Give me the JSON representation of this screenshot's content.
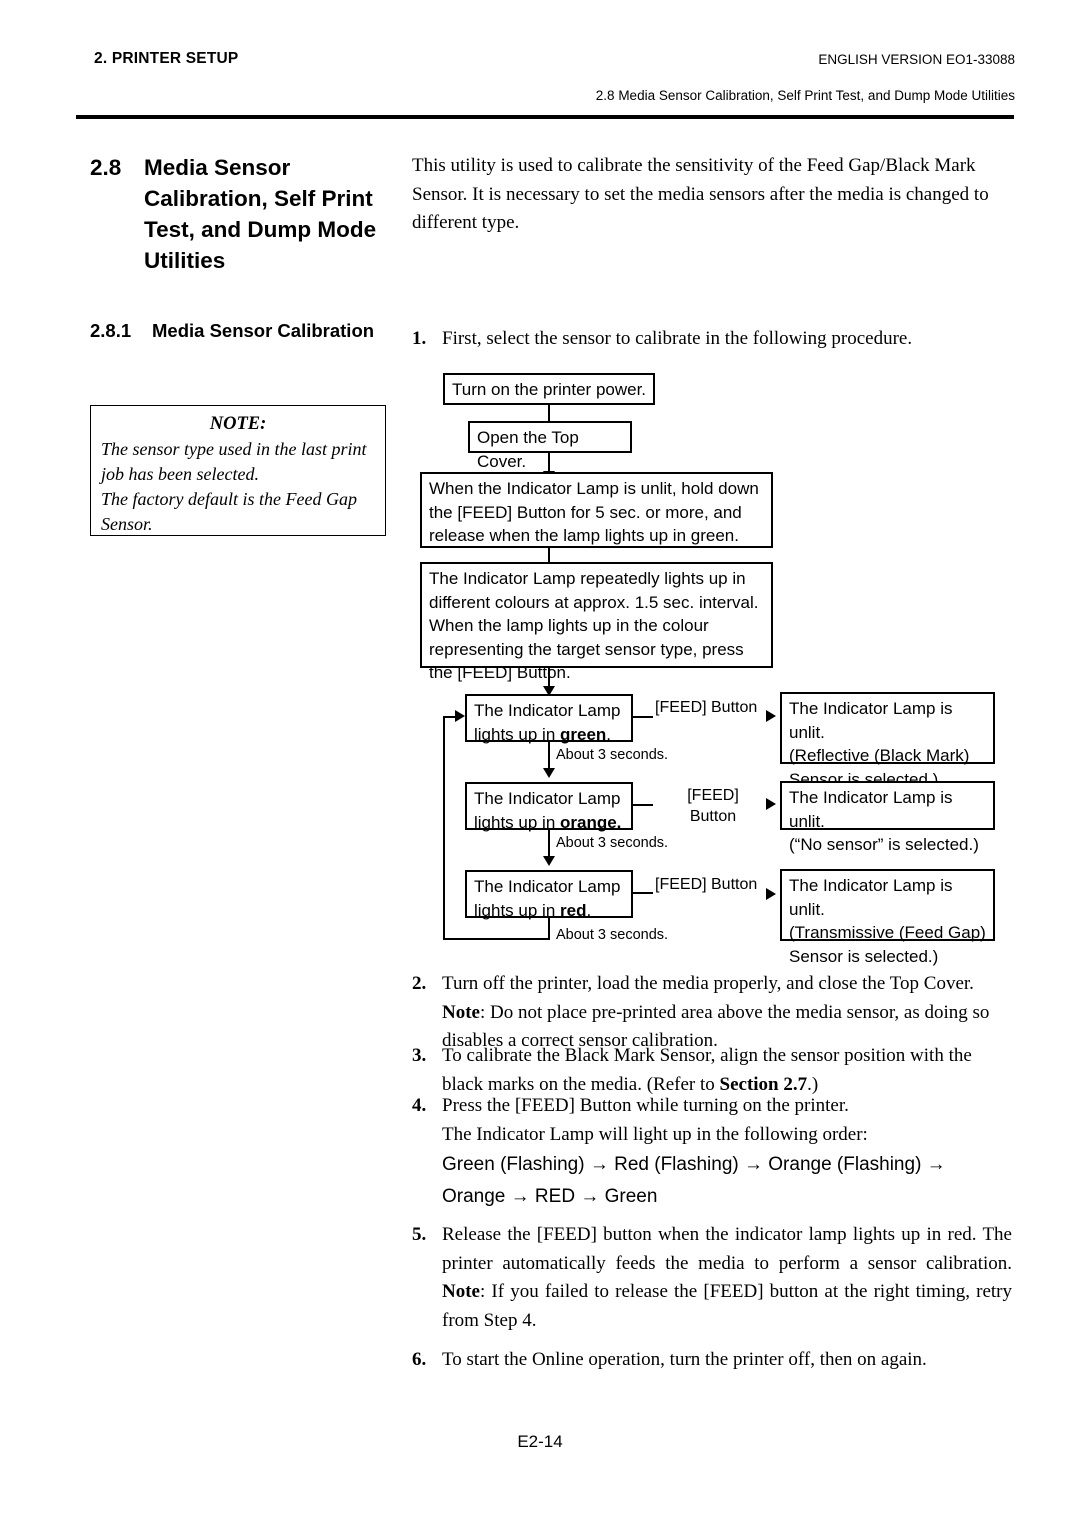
{
  "header": {
    "left": "2. PRINTER SETUP",
    "right": "ENGLISH VERSION EO1-33088",
    "subtitle": "2.8 Media Sensor Calibration, Self Print Test, and Dump Mode Utilities"
  },
  "section": {
    "number": "2.8",
    "title": "Media Sensor Calibration, Self Print Test, and Dump Mode Utilities",
    "intro": "This utility is used to calibrate the sensitivity of the Feed Gap/Black Mark Sensor. It is necessary to set the media sensors after the media is changed to different type."
  },
  "subsection": {
    "number": "2.8.1",
    "title": "Media Sensor Calibration"
  },
  "note_box": {
    "heading": "NOTE:",
    "line1": "The sensor type used in the last print job has been selected.",
    "line2": "The factory default is the Feed Gap Sensor."
  },
  "steps": {
    "s1": {
      "n": "1.",
      "text": "First, select the sensor to calibrate in the following procedure."
    },
    "s2": {
      "n": "2.",
      "text": "Turn off the printer, load the media properly, and close the Top Cover.",
      "note_label": "Note",
      "note_text": ": Do not place pre-printed area above the media sensor, as doing so disables a correct sensor calibration."
    },
    "s3": {
      "n": "3.",
      "text_before": "To calibrate the Black Mark Sensor, align the sensor position with the black marks on the media.  (Refer to ",
      "ref": "Section 2.7",
      "text_after": ".)"
    },
    "s4": {
      "n": "4.",
      "text": "Press the [FEED] Button while turning on the printer.",
      "text2": "The Indicator Lamp will light up in the following order:",
      "sequence_line1": "Green (Flashing)  →  Red (Flashing)  →  Orange (Flashing)  →",
      "sequence_line2": "Orange  →  RED  →  Green"
    },
    "s5": {
      "n": "5.",
      "text": "Release the [FEED] button when the indicator lamp lights up in red. The printer automatically feeds the media to perform a sensor calibration.",
      "note_label": "Note",
      "note_text": ": If you failed to release the [FEED] button at the right timing, retry from Step 4."
    },
    "s6": {
      "n": "6.",
      "text": "To start the Online operation, turn the printer off, then on again."
    }
  },
  "flowchart": {
    "box1": "Turn on the printer power.",
    "box2": "Open the Top Cover.",
    "box3": "When the Indicator Lamp is unlit, hold down the [FEED] Button for 5 sec. or more, and release when the lamp lights up in green.",
    "box4": "The Indicator Lamp repeatedly lights up in different colours at approx. 1.5 sec. interval. When the lamp lights up in the colour representing the target sensor type, press the [FEED] Button.",
    "lamp_green_pre": "The Indicator Lamp lights up in ",
    "lamp_green_colour": "green",
    "lamp_green_post": ".",
    "lamp_orange_pre": "The Indicator Lamp lights up in ",
    "lamp_orange_colour": "orange.",
    "lamp_orange_post": "",
    "lamp_red_pre": "The Indicator Lamp lights up in ",
    "lamp_red_colour": "red",
    "lamp_red_post": ".",
    "feed_label_1": "[FEED] Button",
    "feed_label_2a": "[FEED]",
    "feed_label_2b": "Button",
    "feed_label_3": "[FEED] Button",
    "delay_1": "About 3 seconds.",
    "delay_2": "About 3 seconds.",
    "delay_3": "About 3 seconds.",
    "result_green_l1": "The Indicator Lamp is unlit.",
    "result_green_l2": "(Reflective (Black Mark)",
    "result_green_l3": "Sensor is selected.)",
    "result_orange_l1": "The Indicator Lamp is unlit.",
    "result_orange_l2": "(“No sensor” is selected.)",
    "result_red_l1": "The Indicator Lamp is unlit.",
    "result_red_l2": "(Transmissive (Feed Gap)",
    "result_red_l3": "Sensor is selected.)"
  },
  "footer": {
    "page": "E2-14"
  }
}
